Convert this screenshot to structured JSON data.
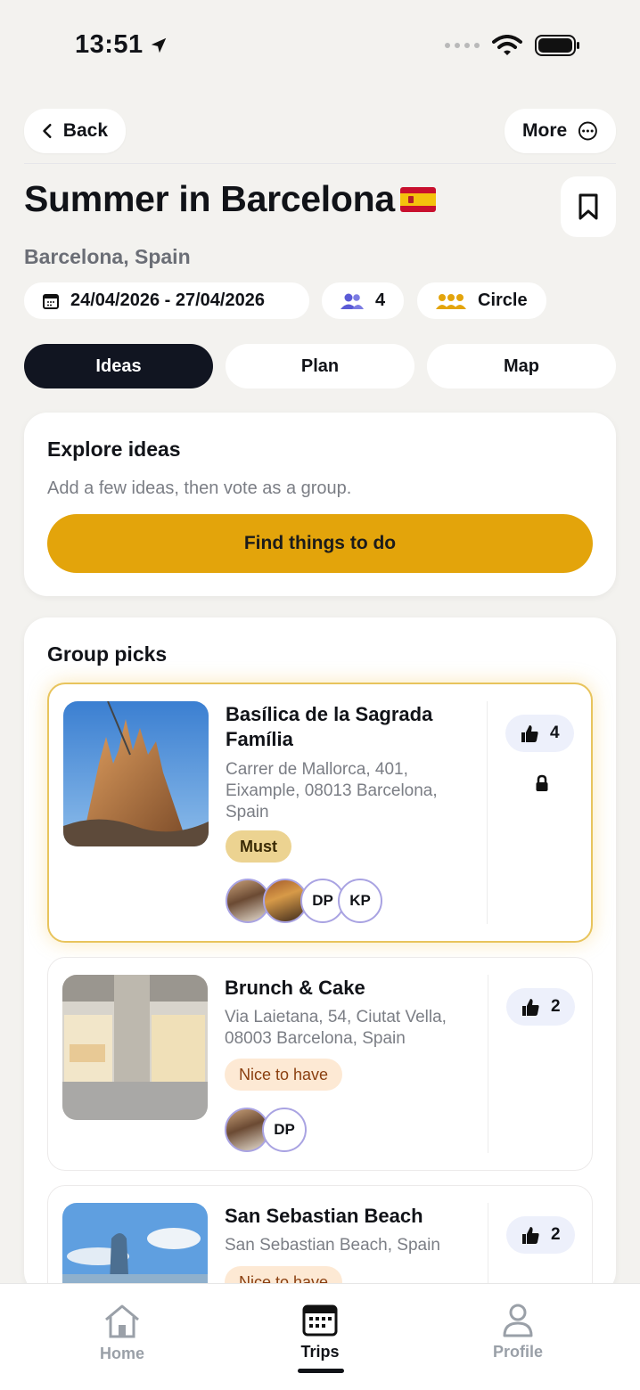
{
  "status": {
    "time": "13:51"
  },
  "nav": {
    "back_label": "Back",
    "more_label": "More"
  },
  "trip": {
    "title": "Summer in Barcelona",
    "location": "Barcelona, Spain",
    "dates": "24/04/2026 - 27/04/2026",
    "people_count": "4",
    "group_label": "Circle"
  },
  "tabs": [
    {
      "label": "Ideas",
      "active": true
    },
    {
      "label": "Plan",
      "active": false
    },
    {
      "label": "Map",
      "active": false
    }
  ],
  "explore": {
    "title": "Explore ideas",
    "subtitle": "Add a few ideas, then vote as a group.",
    "cta_label": "Find things to do"
  },
  "picks": {
    "title": "Group picks",
    "items": [
      {
        "name": "Basílica de la Sagrada Família",
        "address": "Carrer de Mallorca, 401, Eixample, 08013 Barcelona, Spain",
        "tag": "Must",
        "votes": "4",
        "locked": true,
        "avatars": [
          "",
          "",
          "DP",
          "KP"
        ]
      },
      {
        "name": "Brunch & Cake",
        "address": "Via Laietana, 54, Ciutat Vella, 08003 Barcelona, Spain",
        "tag": "Nice to have",
        "votes": "2",
        "avatars": [
          "",
          "DP"
        ]
      },
      {
        "name": "San Sebastian Beach",
        "address": "San Sebastian Beach, Spain",
        "tag": "Nice to have",
        "votes": "2"
      }
    ]
  },
  "bottom_nav": [
    {
      "label": "Home",
      "icon": "home-icon"
    },
    {
      "label": "Trips",
      "icon": "calendar-icon",
      "active": true
    },
    {
      "label": "Profile",
      "icon": "person-icon"
    }
  ],
  "colors": {
    "accent": "#e3a40b",
    "dark": "#111521",
    "vote_bg": "#edf0fb"
  }
}
